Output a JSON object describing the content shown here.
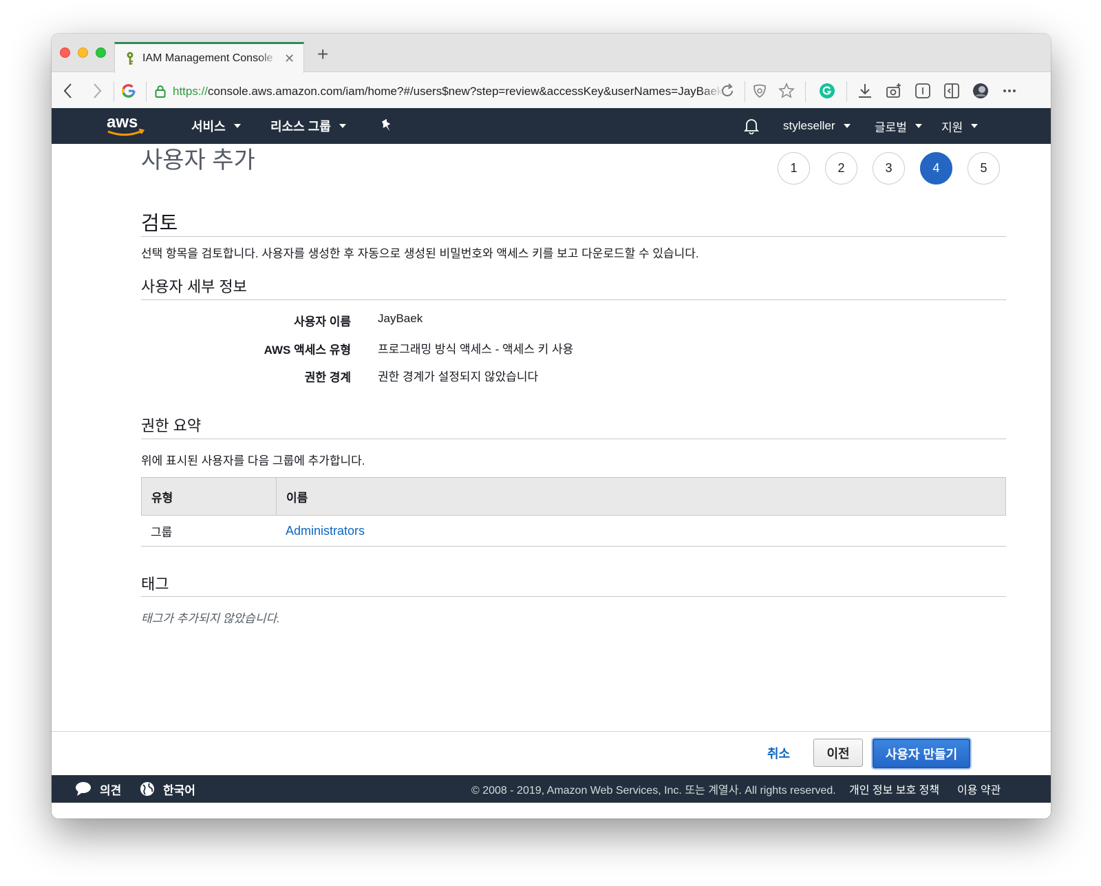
{
  "browser": {
    "tab_title": "IAM Management Console",
    "url_scheme": "https://",
    "url_rest": "console.aws.amazon.com/iam/home?#/users$new?step=review&accessKey&userNames=JayBaek&groups=Administrators"
  },
  "aws_nav": {
    "services": "서비스",
    "resource_groups": "리소스 그룹",
    "account": "styleseller",
    "region": "글로벌",
    "support": "지원"
  },
  "page": {
    "title": "사용자 추가",
    "steps": [
      "1",
      "2",
      "3",
      "4",
      "5"
    ],
    "active_step": "4"
  },
  "review": {
    "heading": "검토",
    "description": "선택 항목을 검토합니다. 사용자를 생성한 후 자동으로 생성된 비밀번호와 액세스 키를 보고 다운로드할 수 있습니다."
  },
  "user_details": {
    "heading": "사용자 세부 정보",
    "rows": [
      {
        "label": "사용자 이름",
        "value": "JayBaek"
      },
      {
        "label": "AWS 액세스 유형",
        "value": "프로그래밍 방식 액세스 - 액세스 키 사용"
      },
      {
        "label": "권한 경계",
        "value": "권한 경계가 설정되지 않았습니다"
      }
    ]
  },
  "permissions": {
    "heading": "권한 요약",
    "description": "위에 표시된 사용자를 다음 그룹에 추가합니다.",
    "columns": [
      "유형",
      "이름"
    ],
    "rows": [
      {
        "type": "그룹",
        "name": "Administrators"
      }
    ]
  },
  "tags": {
    "heading": "태그",
    "empty": "태그가 추가되지 않았습니다."
  },
  "actions": {
    "cancel": "취소",
    "previous": "이전",
    "create": "사용자 만들기"
  },
  "footer": {
    "feedback": "의견",
    "language": "한국어",
    "copyright": "© 2008 - 2019, Amazon Web Services, Inc. 또는 계열사. All rights reserved.",
    "privacy": "개인 정보 보호 정책",
    "terms": "이용 약관"
  },
  "colors": {
    "aws_navy": "#232f3e",
    "primary_blue": "#2466c2",
    "link_blue": "#0c66c1",
    "aws_orange": "#ff9900"
  },
  "icons": {
    "back": "chevron-left-icon",
    "forward": "chevron-right-icon",
    "lock": "lock-icon",
    "reload": "reload-icon",
    "star": "star-icon",
    "bell": "bell-icon",
    "pin": "pin-icon",
    "globe": "globe-icon",
    "chat": "chat-bubble-icon"
  }
}
